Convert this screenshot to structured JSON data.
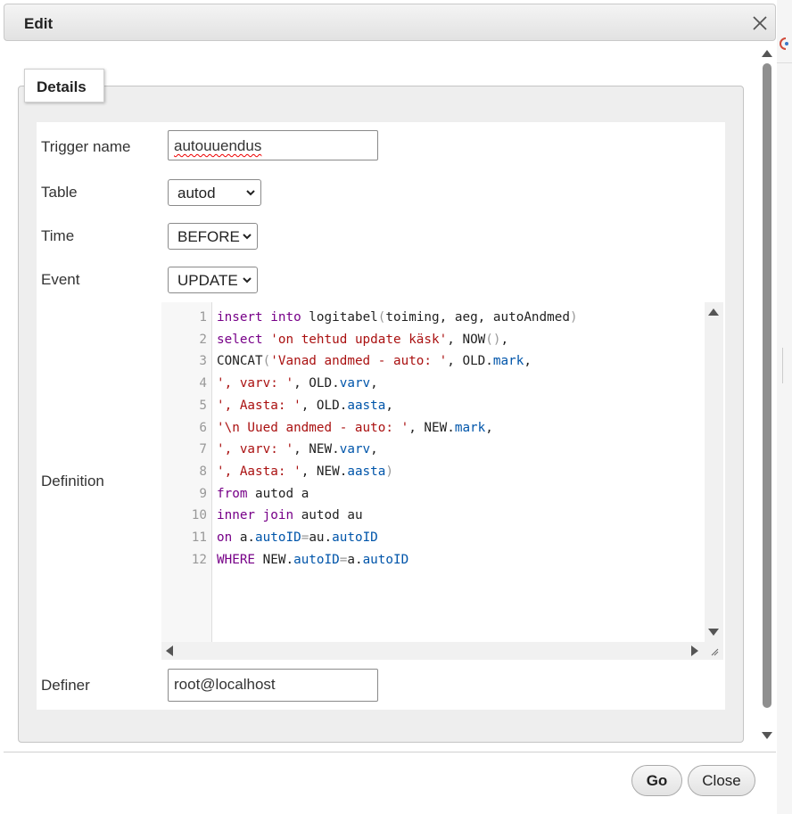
{
  "dialog": {
    "title": "Edit",
    "close_icon": "close-icon"
  },
  "fieldset": {
    "legend": "Details"
  },
  "form": {
    "trigger_name": {
      "label": "Trigger name",
      "value": "autouuendus"
    },
    "table": {
      "label": "Table",
      "value": "autod"
    },
    "time": {
      "label": "Time",
      "value": "BEFORE"
    },
    "event": {
      "label": "Event",
      "value": "UPDATE"
    },
    "definition": {
      "label": "Definition"
    },
    "definer": {
      "label": "Definer",
      "value": "root@localhost"
    }
  },
  "code_lines": [
    [
      [
        "kw",
        "insert"
      ],
      [
        "t",
        " "
      ],
      [
        "kw",
        "into"
      ],
      [
        "t",
        " logitabel"
      ],
      [
        "pun",
        "("
      ],
      [
        "t",
        "toiming, aeg, autoAndmed"
      ],
      [
        "pun",
        ")"
      ]
    ],
    [
      [
        "kw",
        "select"
      ],
      [
        "t",
        " "
      ],
      [
        "str",
        "'on tehtud update käsk'"
      ],
      [
        "t",
        ", NOW"
      ],
      [
        "pun",
        "()"
      ],
      [
        "t",
        ","
      ]
    ],
    [
      [
        "t",
        "CONCAT"
      ],
      [
        "pun",
        "("
      ],
      [
        "str",
        "'Vanad andmed - auto: '"
      ],
      [
        "t",
        ", OLD."
      ],
      [
        "prop",
        "mark"
      ],
      [
        "t",
        ","
      ]
    ],
    [
      [
        "str",
        "', varv: '"
      ],
      [
        "t",
        ", OLD."
      ],
      [
        "prop",
        "varv"
      ],
      [
        "t",
        ","
      ]
    ],
    [
      [
        "str",
        "', Aasta: '"
      ],
      [
        "t",
        ", OLD."
      ],
      [
        "prop",
        "aasta"
      ],
      [
        "t",
        ","
      ]
    ],
    [
      [
        "str",
        "'\\n Uued andmed - auto: '"
      ],
      [
        "t",
        ", NEW."
      ],
      [
        "prop",
        "mark"
      ],
      [
        "t",
        ","
      ]
    ],
    [
      [
        "str",
        "', varv: '"
      ],
      [
        "t",
        ", NEW."
      ],
      [
        "prop",
        "varv"
      ],
      [
        "t",
        ","
      ]
    ],
    [
      [
        "str",
        "', Aasta: '"
      ],
      [
        "t",
        ", NEW."
      ],
      [
        "prop",
        "aasta"
      ],
      [
        "pun",
        ")"
      ]
    ],
    [
      [
        "kw",
        "from"
      ],
      [
        "t",
        " autod a"
      ]
    ],
    [
      [
        "kw",
        "inner"
      ],
      [
        "t",
        " "
      ],
      [
        "kw",
        "join"
      ],
      [
        "t",
        " autod au"
      ]
    ],
    [
      [
        "kw",
        "on"
      ],
      [
        "t",
        " a."
      ],
      [
        "prop",
        "autoID"
      ],
      [
        "pun",
        "="
      ],
      [
        "t",
        "au."
      ],
      [
        "prop",
        "autoID"
      ]
    ],
    [
      [
        "kw",
        "WHERE"
      ],
      [
        "t",
        " NEW."
      ],
      [
        "prop",
        "autoID"
      ],
      [
        "pun",
        "="
      ],
      [
        "t",
        "a."
      ],
      [
        "prop",
        "autoID"
      ]
    ]
  ],
  "buttons": {
    "go": "Go",
    "close": "Close"
  },
  "colors": {
    "keyword": "#770088",
    "string": "#aa1111",
    "property": "#0055aa"
  }
}
